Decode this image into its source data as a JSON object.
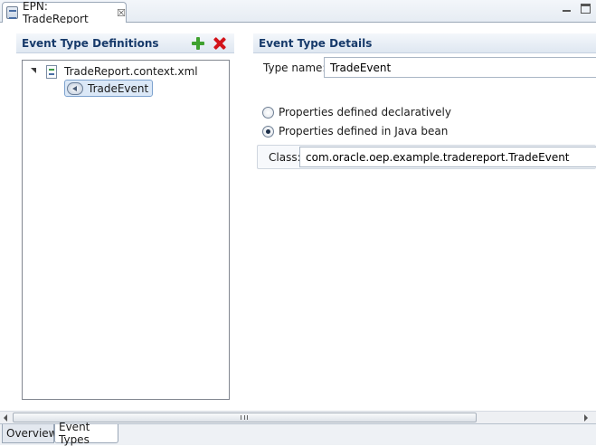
{
  "editor": {
    "tab_title": "EPN: TradeReport",
    "close_glyph": "☒"
  },
  "left_section": {
    "title": "Event Type Definitions",
    "tree": {
      "file": "TradeReport.context.xml",
      "event": "TradeEvent"
    }
  },
  "right_section": {
    "title": "Event Type Details",
    "type_name_label": "Type name:",
    "type_name_value": "TradeEvent",
    "radio_declarative": "Properties defined declaratively",
    "radio_java_bean": "Properties defined in Java bean",
    "class_label": "Class:",
    "class_value": "com.oracle.oep.example.tradereport.TradeEvent"
  },
  "page_tabs": {
    "overview": "Overview",
    "event_types": "Event Types"
  },
  "colors": {
    "section_title": "#173a6a",
    "add_icon": "#3fa12f",
    "delete_icon": "#d3141a",
    "selection": "#dbe8f7"
  },
  "icons": [
    "epn-editor-icon",
    "close-tab-icon",
    "minimize-icon",
    "maximize-icon",
    "add-icon",
    "delete-icon",
    "expand-icon",
    "xml-file-icon",
    "event-type-icon"
  ]
}
